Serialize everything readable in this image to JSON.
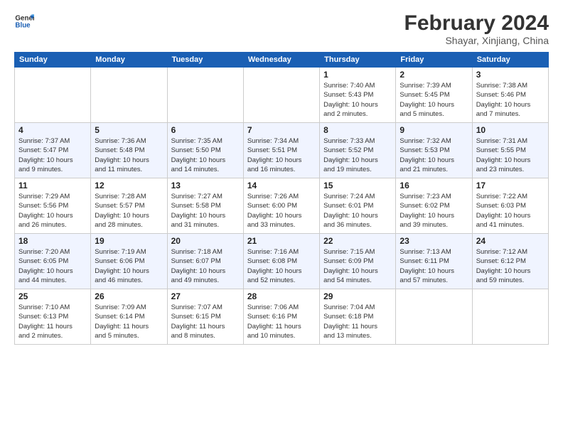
{
  "header": {
    "logo_text_general": "General",
    "logo_text_blue": "Blue",
    "title": "February 2024",
    "subtitle": "Shayar, Xinjiang, China"
  },
  "calendar": {
    "columns": [
      "Sunday",
      "Monday",
      "Tuesday",
      "Wednesday",
      "Thursday",
      "Friday",
      "Saturday"
    ],
    "weeks": [
      [
        {
          "day": "",
          "info": ""
        },
        {
          "day": "",
          "info": ""
        },
        {
          "day": "",
          "info": ""
        },
        {
          "day": "",
          "info": ""
        },
        {
          "day": "1",
          "info": "Sunrise: 7:40 AM\nSunset: 5:43 PM\nDaylight: 10 hours\nand 2 minutes."
        },
        {
          "day": "2",
          "info": "Sunrise: 7:39 AM\nSunset: 5:45 PM\nDaylight: 10 hours\nand 5 minutes."
        },
        {
          "day": "3",
          "info": "Sunrise: 7:38 AM\nSunset: 5:46 PM\nDaylight: 10 hours\nand 7 minutes."
        }
      ],
      [
        {
          "day": "4",
          "info": "Sunrise: 7:37 AM\nSunset: 5:47 PM\nDaylight: 10 hours\nand 9 minutes."
        },
        {
          "day": "5",
          "info": "Sunrise: 7:36 AM\nSunset: 5:48 PM\nDaylight: 10 hours\nand 11 minutes."
        },
        {
          "day": "6",
          "info": "Sunrise: 7:35 AM\nSunset: 5:50 PM\nDaylight: 10 hours\nand 14 minutes."
        },
        {
          "day": "7",
          "info": "Sunrise: 7:34 AM\nSunset: 5:51 PM\nDaylight: 10 hours\nand 16 minutes."
        },
        {
          "day": "8",
          "info": "Sunrise: 7:33 AM\nSunset: 5:52 PM\nDaylight: 10 hours\nand 19 minutes."
        },
        {
          "day": "9",
          "info": "Sunrise: 7:32 AM\nSunset: 5:53 PM\nDaylight: 10 hours\nand 21 minutes."
        },
        {
          "day": "10",
          "info": "Sunrise: 7:31 AM\nSunset: 5:55 PM\nDaylight: 10 hours\nand 23 minutes."
        }
      ],
      [
        {
          "day": "11",
          "info": "Sunrise: 7:29 AM\nSunset: 5:56 PM\nDaylight: 10 hours\nand 26 minutes."
        },
        {
          "day": "12",
          "info": "Sunrise: 7:28 AM\nSunset: 5:57 PM\nDaylight: 10 hours\nand 28 minutes."
        },
        {
          "day": "13",
          "info": "Sunrise: 7:27 AM\nSunset: 5:58 PM\nDaylight: 10 hours\nand 31 minutes."
        },
        {
          "day": "14",
          "info": "Sunrise: 7:26 AM\nSunset: 6:00 PM\nDaylight: 10 hours\nand 33 minutes."
        },
        {
          "day": "15",
          "info": "Sunrise: 7:24 AM\nSunset: 6:01 PM\nDaylight: 10 hours\nand 36 minutes."
        },
        {
          "day": "16",
          "info": "Sunrise: 7:23 AM\nSunset: 6:02 PM\nDaylight: 10 hours\nand 39 minutes."
        },
        {
          "day": "17",
          "info": "Sunrise: 7:22 AM\nSunset: 6:03 PM\nDaylight: 10 hours\nand 41 minutes."
        }
      ],
      [
        {
          "day": "18",
          "info": "Sunrise: 7:20 AM\nSunset: 6:05 PM\nDaylight: 10 hours\nand 44 minutes."
        },
        {
          "day": "19",
          "info": "Sunrise: 7:19 AM\nSunset: 6:06 PM\nDaylight: 10 hours\nand 46 minutes."
        },
        {
          "day": "20",
          "info": "Sunrise: 7:18 AM\nSunset: 6:07 PM\nDaylight: 10 hours\nand 49 minutes."
        },
        {
          "day": "21",
          "info": "Sunrise: 7:16 AM\nSunset: 6:08 PM\nDaylight: 10 hours\nand 52 minutes."
        },
        {
          "day": "22",
          "info": "Sunrise: 7:15 AM\nSunset: 6:09 PM\nDaylight: 10 hours\nand 54 minutes."
        },
        {
          "day": "23",
          "info": "Sunrise: 7:13 AM\nSunset: 6:11 PM\nDaylight: 10 hours\nand 57 minutes."
        },
        {
          "day": "24",
          "info": "Sunrise: 7:12 AM\nSunset: 6:12 PM\nDaylight: 10 hours\nand 59 minutes."
        }
      ],
      [
        {
          "day": "25",
          "info": "Sunrise: 7:10 AM\nSunset: 6:13 PM\nDaylight: 11 hours\nand 2 minutes."
        },
        {
          "day": "26",
          "info": "Sunrise: 7:09 AM\nSunset: 6:14 PM\nDaylight: 11 hours\nand 5 minutes."
        },
        {
          "day": "27",
          "info": "Sunrise: 7:07 AM\nSunset: 6:15 PM\nDaylight: 11 hours\nand 8 minutes."
        },
        {
          "day": "28",
          "info": "Sunrise: 7:06 AM\nSunset: 6:16 PM\nDaylight: 11 hours\nand 10 minutes."
        },
        {
          "day": "29",
          "info": "Sunrise: 7:04 AM\nSunset: 6:18 PM\nDaylight: 11 hours\nand 13 minutes."
        },
        {
          "day": "",
          "info": ""
        },
        {
          "day": "",
          "info": ""
        }
      ]
    ]
  }
}
